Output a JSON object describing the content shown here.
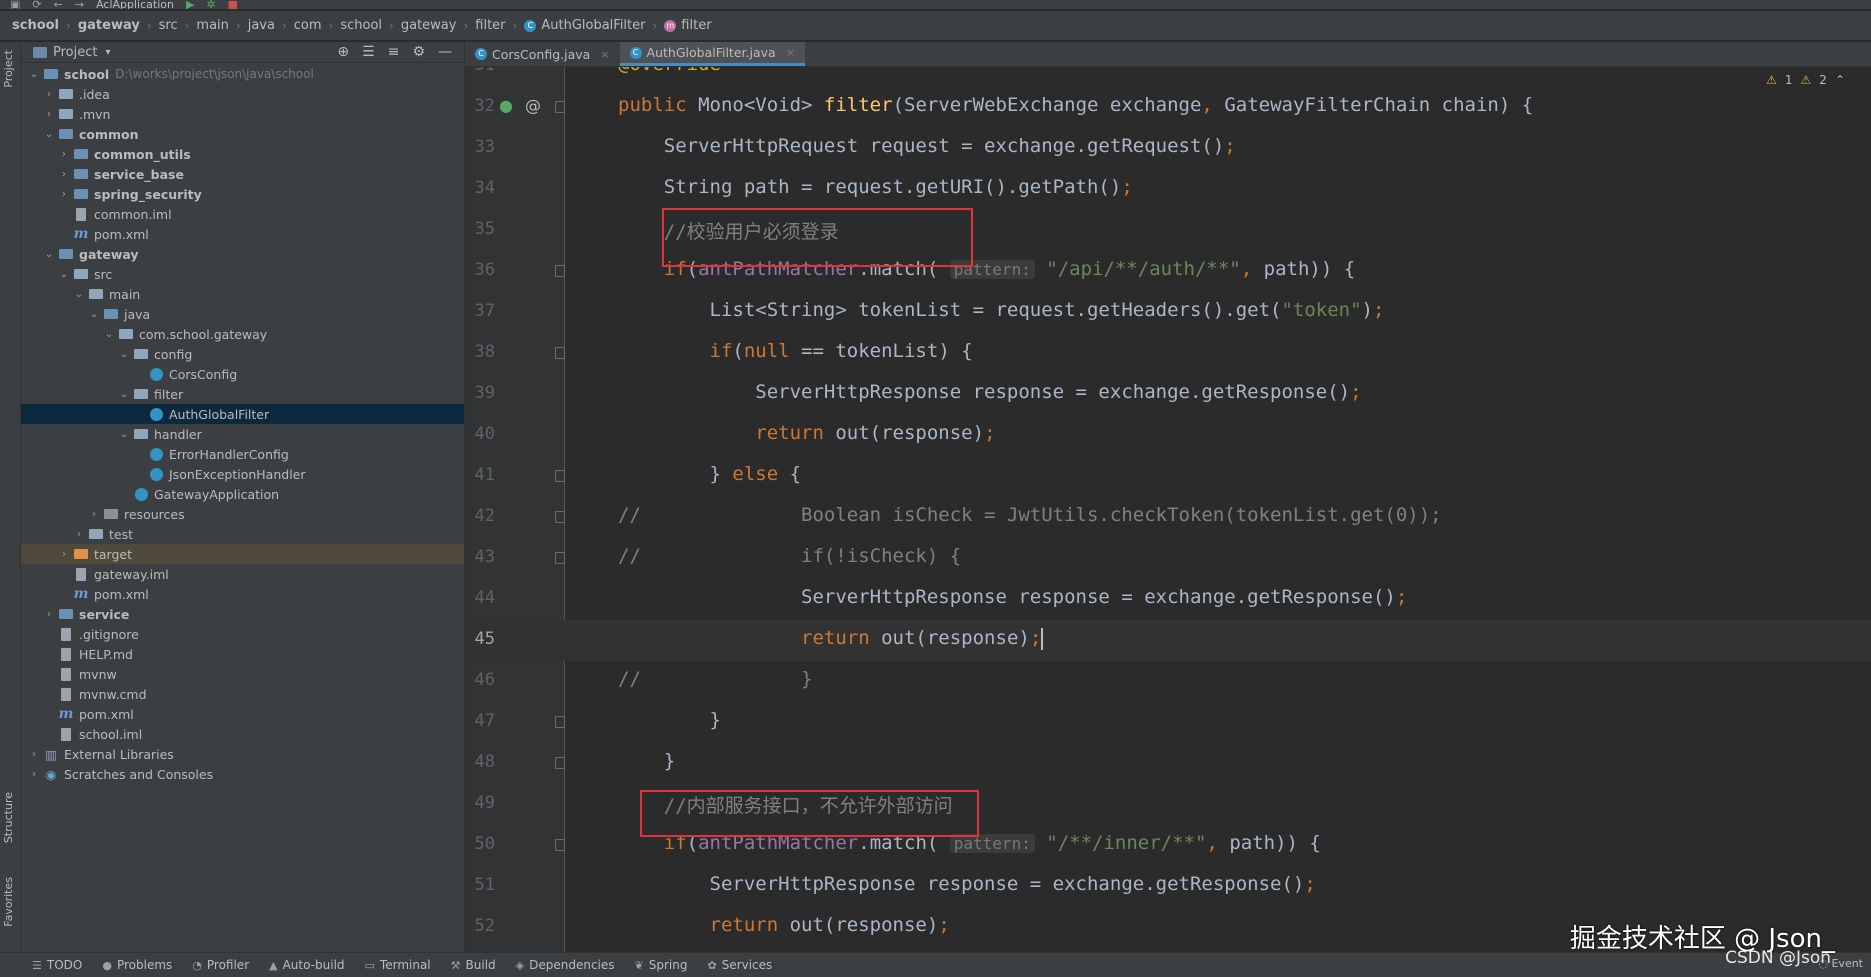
{
  "toolbar": {
    "run_config": "AclApplication",
    "colors": {
      "run": "#59a869",
      "stop": "#c75450"
    }
  },
  "breadcrumb": [
    "school",
    "gateway",
    "src",
    "main",
    "java",
    "com",
    "school",
    "gateway",
    "filter",
    "AuthGlobalFilter",
    "filter"
  ],
  "side_strip": {
    "project": "Project",
    "structure": "Structure",
    "favorites": "Favorites"
  },
  "project_panel": {
    "title": "Project",
    "tree": [
      {
        "label": "school",
        "path": "D:\\works\\project\\json\\java\\school",
        "bold": true,
        "depth": 0,
        "arrow": "down",
        "icon": "module-folder"
      },
      {
        "label": ".idea",
        "depth": 1,
        "arrow": "right",
        "icon": "folder"
      },
      {
        "label": ".mvn",
        "depth": 1,
        "arrow": "right",
        "icon": "folder"
      },
      {
        "label": "common",
        "bold": true,
        "depth": 1,
        "arrow": "down",
        "icon": "module-folder"
      },
      {
        "label": "common_utils",
        "bold": true,
        "depth": 2,
        "arrow": "right",
        "icon": "module-folder"
      },
      {
        "label": "service_base",
        "bold": true,
        "depth": 2,
        "arrow": "right",
        "icon": "module-folder"
      },
      {
        "label": "spring_security",
        "bold": true,
        "depth": 2,
        "arrow": "right",
        "icon": "module-folder"
      },
      {
        "label": "common.iml",
        "depth": 2,
        "arrow": "none",
        "icon": "file"
      },
      {
        "label": "pom.xml",
        "depth": 2,
        "arrow": "none",
        "icon": "maven"
      },
      {
        "label": "gateway",
        "bold": true,
        "depth": 1,
        "arrow": "down",
        "icon": "module-folder"
      },
      {
        "label": "src",
        "depth": 2,
        "arrow": "down",
        "icon": "folder"
      },
      {
        "label": "main",
        "depth": 3,
        "arrow": "down",
        "icon": "folder"
      },
      {
        "label": "java",
        "depth": 4,
        "arrow": "down",
        "icon": "source-folder"
      },
      {
        "label": "com.school.gateway",
        "depth": 5,
        "arrow": "down",
        "icon": "folder"
      },
      {
        "label": "config",
        "depth": 6,
        "arrow": "down",
        "icon": "folder"
      },
      {
        "label": "CorsConfig",
        "depth": 7,
        "arrow": "none",
        "icon": "class"
      },
      {
        "label": "filter",
        "depth": 6,
        "arrow": "down",
        "icon": "folder"
      },
      {
        "label": "AuthGlobalFilter",
        "depth": 7,
        "arrow": "none",
        "icon": "class",
        "selected": true
      },
      {
        "label": "handler",
        "depth": 6,
        "arrow": "down",
        "icon": "folder"
      },
      {
        "label": "ErrorHandlerConfig",
        "depth": 7,
        "arrow": "none",
        "icon": "class"
      },
      {
        "label": "JsonExceptionHandler",
        "depth": 7,
        "arrow": "none",
        "icon": "class"
      },
      {
        "label": "GatewayApplication",
        "depth": 6,
        "arrow": "none",
        "icon": "class"
      },
      {
        "label": "resources",
        "depth": 4,
        "arrow": "right",
        "icon": "resources-folder"
      },
      {
        "label": "test",
        "depth": 3,
        "arrow": "right",
        "icon": "folder"
      },
      {
        "label": "target",
        "depth": 2,
        "arrow": "right",
        "icon": "excluded-folder",
        "highlight": true
      },
      {
        "label": "gateway.iml",
        "depth": 2,
        "arrow": "none",
        "icon": "file"
      },
      {
        "label": "pom.xml",
        "depth": 2,
        "arrow": "none",
        "icon": "maven"
      },
      {
        "label": "service",
        "bold": true,
        "depth": 1,
        "arrow": "right",
        "icon": "module-folder"
      },
      {
        "label": ".gitignore",
        "depth": 1,
        "arrow": "none",
        "icon": "file"
      },
      {
        "label": "HELP.md",
        "depth": 1,
        "arrow": "none",
        "icon": "file"
      },
      {
        "label": "mvnw",
        "depth": 1,
        "arrow": "none",
        "icon": "file"
      },
      {
        "label": "mvnw.cmd",
        "depth": 1,
        "arrow": "none",
        "icon": "file"
      },
      {
        "label": "pom.xml",
        "depth": 1,
        "arrow": "none",
        "icon": "maven"
      },
      {
        "label": "school.iml",
        "depth": 1,
        "arrow": "none",
        "icon": "file"
      },
      {
        "label": "External Libraries",
        "depth": 0,
        "arrow": "right",
        "icon": "libraries"
      },
      {
        "label": "Scratches and Consoles",
        "depth": 0,
        "arrow": "right",
        "icon": "scratches"
      }
    ]
  },
  "tabs": [
    {
      "label": "CorsConfig.java",
      "active": false
    },
    {
      "label": "AuthGlobalFilter.java",
      "active": true
    }
  ],
  "editor": {
    "warnings": {
      "warn": "1",
      "weak": "2"
    },
    "lines": [
      {
        "n": "31",
        "tokens": [
          [
            "ann",
            "@Override"
          ]
        ]
      },
      {
        "n": "32",
        "tokens": [
          [
            "kw",
            "public "
          ],
          [
            "",
            "Mono<Void> "
          ],
          [
            "fn",
            "filter"
          ],
          [
            "",
            "(ServerWebExchange exchange"
          ],
          [
            "kw",
            ", "
          ],
          [
            "",
            "GatewayFilterChain chain) {"
          ]
        ]
      },
      {
        "n": "33",
        "tokens": [
          [
            "",
            "    ServerHttpRequest request = exchange.getRequest()"
          ],
          [
            "kw",
            ";"
          ]
        ]
      },
      {
        "n": "34",
        "tokens": [
          [
            "",
            "    String path = request.getURI().getPath()"
          ],
          [
            "kw",
            ";"
          ]
        ]
      },
      {
        "n": "35",
        "tokens": [
          [
            "cm",
            "    //校验用户必须登录"
          ]
        ]
      },
      {
        "n": "36",
        "tokens": [
          [
            "kw",
            "    if"
          ],
          [
            "",
            "("
          ],
          [
            "fld",
            "antPathMatcher"
          ],
          [
            "",
            ".match( "
          ],
          [
            "hint",
            "pattern:"
          ],
          [
            "str",
            " \"/api/**/auth/**\""
          ],
          [
            "kw",
            ", "
          ],
          [
            "",
            "path)) {"
          ]
        ]
      },
      {
        "n": "37",
        "tokens": [
          [
            "",
            "        List<String> tokenList = request.getHeaders().get("
          ],
          [
            "str",
            "\"token\""
          ],
          [
            "",
            ")"
          ],
          [
            "kw",
            ";"
          ]
        ]
      },
      {
        "n": "38",
        "tokens": [
          [
            "kw",
            "        if"
          ],
          [
            "",
            "("
          ],
          [
            "kw",
            "null "
          ],
          [
            "",
            "== tokenList) {"
          ]
        ]
      },
      {
        "n": "39",
        "tokens": [
          [
            "",
            "            ServerHttpResponse response = exchange.getResponse()"
          ],
          [
            "kw",
            ";"
          ]
        ]
      },
      {
        "n": "40",
        "tokens": [
          [
            "kw",
            "            return "
          ],
          [
            "",
            "out(response)"
          ],
          [
            "kw",
            ";"
          ]
        ]
      },
      {
        "n": "41",
        "tokens": [
          [
            "",
            "        } "
          ],
          [
            "kw",
            "else "
          ],
          [
            "",
            "{"
          ]
        ]
      },
      {
        "n": "42",
        "tokens": [
          [
            "cm",
            "//              Boolean isCheck = JwtUtils.checkToken(tokenList.get(0));"
          ]
        ]
      },
      {
        "n": "43",
        "tokens": [
          [
            "cm",
            "//              if(!isCheck) {"
          ]
        ]
      },
      {
        "n": "44",
        "tokens": [
          [
            "",
            "                ServerHttpResponse response = exchange.getResponse()"
          ],
          [
            "kw",
            ";"
          ]
        ]
      },
      {
        "n": "45",
        "tokens": [
          [
            "kw",
            "                return "
          ],
          [
            "",
            "out(response)"
          ],
          [
            "kw",
            ";"
          ]
        ],
        "current": true
      },
      {
        "n": "46",
        "tokens": [
          [
            "cm",
            "//              }"
          ]
        ]
      },
      {
        "n": "47",
        "tokens": [
          [
            "",
            "        }"
          ]
        ]
      },
      {
        "n": "48",
        "tokens": [
          [
            "",
            "    }"
          ]
        ]
      },
      {
        "n": "49",
        "tokens": [
          [
            "cm",
            "    //内部服务接口，不允许外部访问"
          ]
        ]
      },
      {
        "n": "50",
        "tokens": [
          [
            "kw",
            "    if"
          ],
          [
            "",
            "("
          ],
          [
            "fld",
            "antPathMatcher"
          ],
          [
            "",
            ".match( "
          ],
          [
            "hint",
            "pattern:"
          ],
          [
            "str",
            " \"/**/inner/**\""
          ],
          [
            "kw",
            ", "
          ],
          [
            "",
            "path)) {"
          ]
        ]
      },
      {
        "n": "51",
        "tokens": [
          [
            "",
            "        ServerHttpResponse response = exchange.getResponse()"
          ],
          [
            "kw",
            ";"
          ]
        ]
      },
      {
        "n": "52",
        "tokens": [
          [
            "kw",
            "        return "
          ],
          [
            "",
            "out(response)"
          ],
          [
            "kw",
            ";"
          ]
        ]
      }
    ]
  },
  "status_bar": [
    "TODO",
    "Problems",
    "Profiler",
    "Auto-build",
    "Terminal",
    "Build",
    "Dependencies",
    "Spring",
    "Services"
  ],
  "event_log": "Event",
  "watermark": {
    "main": "掘金技术社区 @ Json_",
    "sub": "CSDN @Json"
  }
}
